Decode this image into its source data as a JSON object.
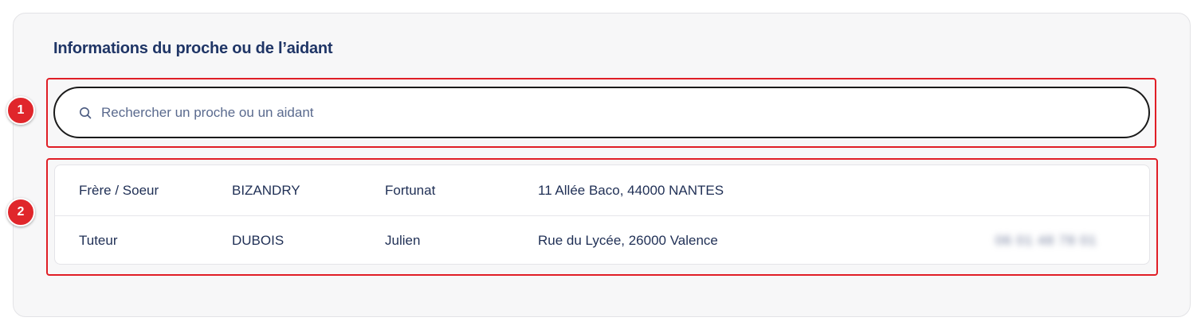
{
  "section": {
    "title": "Informations du proche ou de l’aidant"
  },
  "annotations": [
    "1",
    "2"
  ],
  "search": {
    "placeholder": "Rechercher un proche ou un aidant",
    "value": "",
    "icon": "search-icon"
  },
  "contacts": [
    {
      "relation": "Frère / Soeur",
      "last_name": "BIZANDRY",
      "first_name": "Fortunat",
      "address": "11 Allée Baco, 44000 NANTES",
      "phone": ""
    },
    {
      "relation": "Tuteur",
      "last_name": "DUBOIS",
      "first_name": "Julien",
      "address": "Rue du Lycée, 26000 Valence",
      "phone": "06 01 48 78 01"
    }
  ]
}
